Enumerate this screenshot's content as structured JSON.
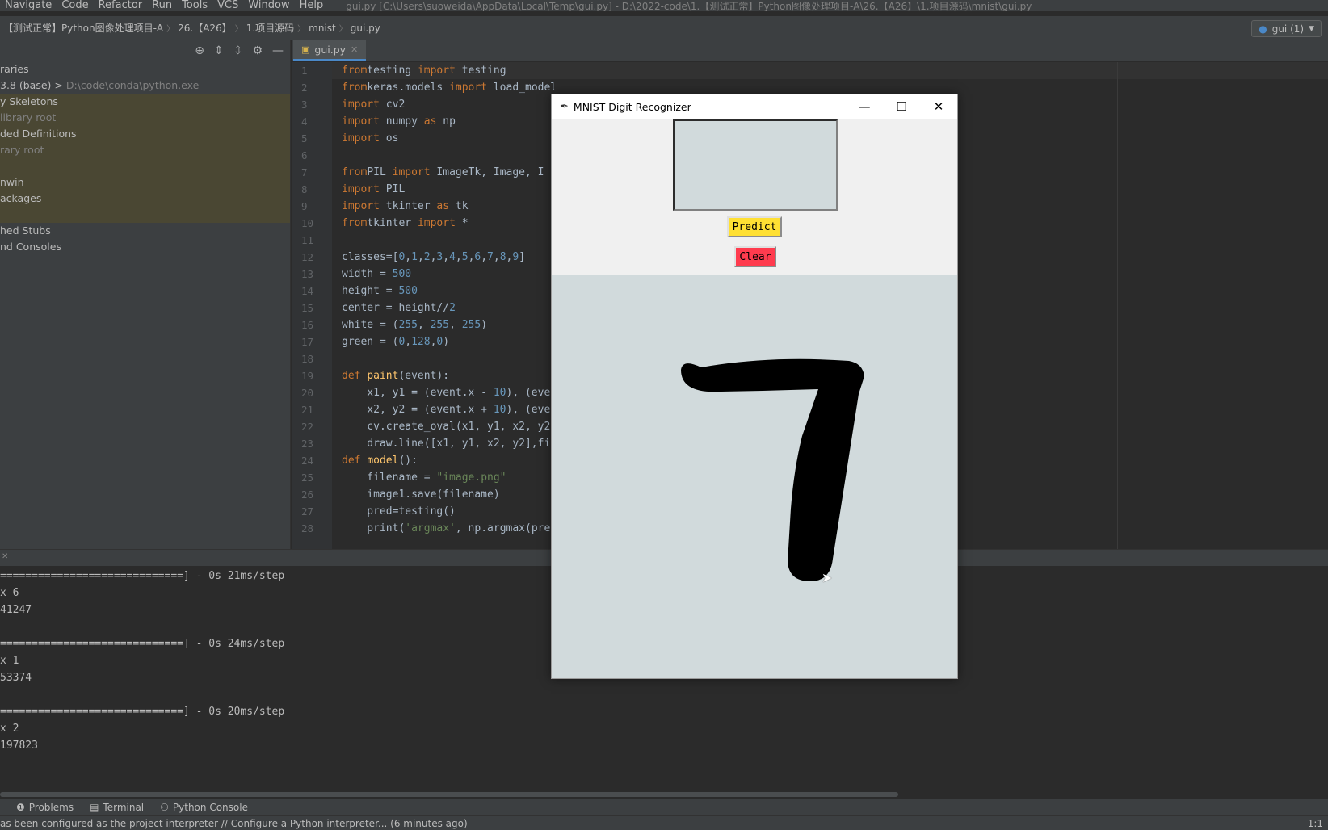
{
  "menu": {
    "items": [
      "Navigate",
      "Code",
      "Refactor",
      "Run",
      "Tools",
      "VCS",
      "Window",
      "Help"
    ],
    "window_title": "gui.py [C:\\Users\\suoweida\\AppData\\Local\\Temp\\gui.py] - D:\\2022-code\\1.【测试正常】Python图像处理项目-A\\26.【A26】\\1.项目源码\\mnist\\gui.py"
  },
  "breadcrumb": {
    "items": [
      "【测试正常】Python图像处理项目-A",
      "26.【A26】",
      "1.项目源码",
      "mnist",
      "gui.py"
    ],
    "run_config": "gui (1)"
  },
  "project": {
    "rows": [
      {
        "text": "raries",
        "dim": "",
        "hl": false
      },
      {
        "text": " 3.8 (base) >",
        "dim": " D:\\code\\conda\\python.exe",
        "hl": false
      },
      {
        "text": "y Skeletons",
        "dim": "",
        "hl": true
      },
      {
        "text": "",
        "dim": "library root",
        "hl": true
      },
      {
        "text": "ded Definitions",
        "dim": "",
        "hl": true
      },
      {
        "text": "",
        "dim": "rary root",
        "hl": true
      },
      {
        "text": "",
        "dim": "",
        "hl": true
      },
      {
        "text": "nwin",
        "dim": "",
        "hl": true
      },
      {
        "text": "ackages",
        "dim": "",
        "hl": true
      },
      {
        "text": "",
        "dim": "",
        "hl": true
      },
      {
        "text": "hed Stubs",
        "dim": "",
        "hl": false
      },
      {
        "text": "nd Consoles",
        "dim": "",
        "hl": false
      }
    ]
  },
  "editor": {
    "tab_label": "gui.py",
    "line_numbers": [
      "1",
      "2",
      "3",
      "4",
      "5",
      "6",
      "7",
      "8",
      "9",
      "10",
      "11",
      "12",
      "13",
      "14",
      "15",
      "16",
      "17",
      "18",
      "19",
      "20",
      "21",
      "22",
      "23",
      "24",
      "25",
      "26",
      "27",
      "28"
    ],
    "code": [
      [
        [
          "kw",
          "from"
        ],
        [
          "",
          "testing "
        ],
        [
          "kw",
          "import"
        ],
        [
          "",
          " testing"
        ]
      ],
      [
        [
          "kw",
          "from"
        ],
        [
          "",
          "keras.models "
        ],
        [
          "kw",
          "import"
        ],
        [
          "",
          " load_model"
        ]
      ],
      [
        [
          "kw",
          "import"
        ],
        [
          "",
          " cv2"
        ]
      ],
      [
        [
          "kw",
          "import"
        ],
        [
          "",
          " numpy "
        ],
        [
          "kw",
          "as"
        ],
        [
          "",
          " np"
        ]
      ],
      [
        [
          "kw",
          "import"
        ],
        [
          "",
          " os"
        ]
      ],
      [
        [
          "",
          ""
        ]
      ],
      [
        [
          "kw",
          "from"
        ],
        [
          "",
          "PIL "
        ],
        [
          "kw",
          "import"
        ],
        [
          "",
          " ImageTk, Image, I"
        ]
      ],
      [
        [
          "kw",
          "import"
        ],
        [
          "",
          " PIL"
        ]
      ],
      [
        [
          "kw",
          "import"
        ],
        [
          "",
          " tkinter "
        ],
        [
          "kw",
          "as"
        ],
        [
          "",
          " tk"
        ]
      ],
      [
        [
          "kw",
          "from"
        ],
        [
          "",
          "tkinter "
        ],
        [
          "kw",
          "import"
        ],
        [
          "",
          " *"
        ]
      ],
      [
        [
          "",
          ""
        ]
      ],
      [
        [
          "",
          "classes=["
        ],
        [
          "num",
          "0"
        ],
        [
          "",
          ","
        ],
        [
          "num",
          "1"
        ],
        [
          "",
          ","
        ],
        [
          "num",
          "2"
        ],
        [
          "",
          ","
        ],
        [
          "num",
          "3"
        ],
        [
          "",
          ","
        ],
        [
          "num",
          "4"
        ],
        [
          "",
          ","
        ],
        [
          "num",
          "5"
        ],
        [
          "",
          ","
        ],
        [
          "num",
          "6"
        ],
        [
          "",
          ","
        ],
        [
          "num",
          "7"
        ],
        [
          "",
          ","
        ],
        [
          "num",
          "8"
        ],
        [
          "",
          ","
        ],
        [
          "num",
          "9"
        ],
        [
          "",
          "]"
        ]
      ],
      [
        [
          "",
          "width = "
        ],
        [
          "num",
          "500"
        ]
      ],
      [
        [
          "",
          "height = "
        ],
        [
          "num",
          "500"
        ]
      ],
      [
        [
          "",
          "center = height//"
        ],
        [
          "num",
          "2"
        ]
      ],
      [
        [
          "",
          "white = ("
        ],
        [
          "num",
          "255"
        ],
        [
          "",
          ", "
        ],
        [
          "num",
          "255"
        ],
        [
          "",
          ", "
        ],
        [
          "num",
          "255"
        ],
        [
          "",
          ")"
        ]
      ],
      [
        [
          "",
          "green = ("
        ],
        [
          "num",
          "0"
        ],
        [
          "",
          ","
        ],
        [
          "num",
          "128"
        ],
        [
          "",
          ","
        ],
        [
          "num",
          "0"
        ],
        [
          "",
          ")"
        ]
      ],
      [
        [
          "",
          ""
        ]
      ],
      [
        [
          "kw",
          "def "
        ],
        [
          "fn",
          "paint"
        ],
        [
          "",
          "(event):"
        ]
      ],
      [
        [
          "",
          "    x1, y1 = (event.x - "
        ],
        [
          "num",
          "10"
        ],
        [
          "",
          "), (eve"
        ]
      ],
      [
        [
          "",
          "    x2, y2 = (event.x + "
        ],
        [
          "num",
          "10"
        ],
        [
          "",
          "), (eve"
        ]
      ],
      [
        [
          "",
          "    cv.create_oval(x1, y1, x2, y2"
        ]
      ],
      [
        [
          "",
          "    draw.line([x1, y1, x2, y2],fi"
        ]
      ],
      [
        [
          "kw",
          "def "
        ],
        [
          "fn",
          "model"
        ],
        [
          "",
          "():"
        ]
      ],
      [
        [
          "",
          "    filename = "
        ],
        [
          "str",
          "\"image.png\""
        ]
      ],
      [
        [
          "",
          "    image1.save(filename)"
        ]
      ],
      [
        [
          "",
          "    pred=testing()"
        ]
      ],
      [
        [
          "",
          "    print("
        ],
        [
          "str",
          "'argmax'"
        ],
        [
          "",
          ", np.argmax(pred"
        ]
      ]
    ]
  },
  "console": {
    "lines": [
      "=============================] - 0s 21ms/step",
      "x 6",
      "41247",
      "",
      "=============================] - 0s 24ms/step",
      "x 1",
      "53374",
      "",
      "=============================] - 0s 20ms/step",
      "x 2",
      "197823"
    ]
  },
  "toolwindows": {
    "problems": "Problems",
    "terminal": "Terminal",
    "python_console": "Python Console"
  },
  "status": {
    "message": "as been configured as the project interpreter // Configure a Python interpreter... (6 minutes ago)",
    "position": "1:1"
  },
  "tk": {
    "title": "MNIST Digit Recognizer",
    "predict_label": "Predict",
    "clear_label": "Clear"
  }
}
